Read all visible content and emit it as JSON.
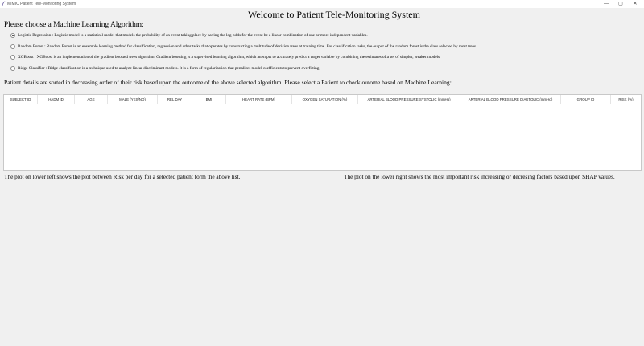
{
  "window": {
    "title": "MIMIC Patient Tele-Monitoring System",
    "minimize_glyph": "—",
    "maximize_glyph": "▢",
    "close_glyph": "✕"
  },
  "heading": "Welcome to Patient Tele-Monitoring System",
  "algorithm_prompt": "Please choose a Machine Learning Algorithm:",
  "algorithms": [
    {
      "label": "Logistic Regression : Logistic model is a statistical model that models the probability of an event taking place by having the log-odds for the event be a linear combination of one or more independent variables.",
      "selected": true
    },
    {
      "label": "Random Forest : Random Forest is an ensemble learning method for classification, regression and other tasks that operates by constructing a multitude of decision trees at training time. For classification tasks, the output of the random forest is the class selected by most trees",
      "selected": false
    },
    {
      "label": "XGBoost : XGBoost is an implementation of the gradient boosted trees algorithm. Gradient boosting is a supervised learning algorithm, which attempts to accurately predict a target variable by combining the estimates of a set of simpler, weaker models",
      "selected": false
    },
    {
      "label": "Ridge Classifier : Ridge classification is a technique used to analyze linear discriminant models. It is a form of regularization that penalizes model coefficients to prevent overfitting",
      "selected": false
    }
  ],
  "patients_prompt": "Patient details are sorted in decreasing order of their risk based upon the outcome of the above selected algorithm. Please select a Patient to check outome based on Machine Learning:",
  "table": {
    "columns": [
      "SUBJECT ID",
      "HADM ID",
      "AGE",
      "MALE (YES/NO)",
      "REL DAY",
      "BMI",
      "HEART RATE (BPM)",
      "OXYGEN SATURATION (%)",
      "ARTERIAL BLOOD PRESSURE SYSTOLIC (mmHg)",
      "ARTERIAL BLOOD PRESSURE DIASTOLIC (mmHg)",
      "GROUP ID",
      "RISK (%)"
    ],
    "rows": []
  },
  "plot_left_caption": "The plot on lower left shows the plot between Risk per day for a selected patient form the above list.",
  "plot_right_caption": "The plot on the lower right shows the most important risk increasing or decresing factors based upon SHAP values."
}
